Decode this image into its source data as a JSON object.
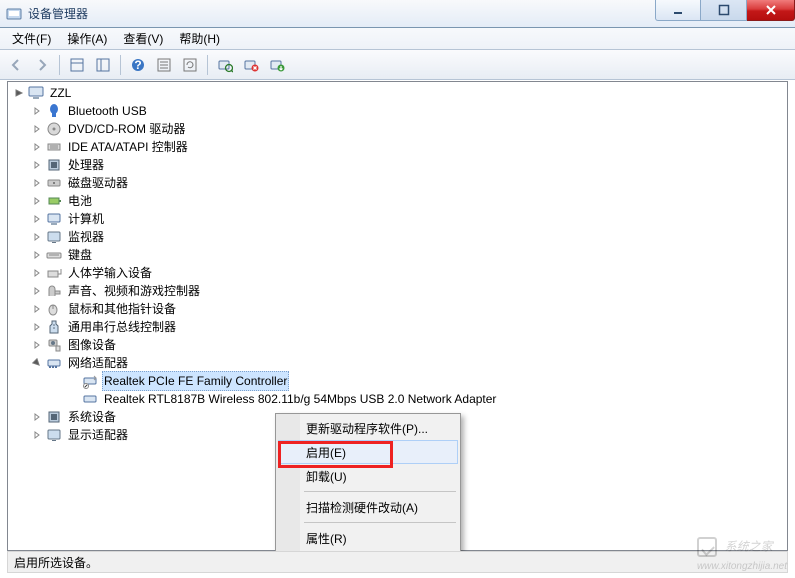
{
  "window": {
    "title": "设备管理器"
  },
  "menubar": {
    "file": "文件(F)",
    "action": "操作(A)",
    "view": "查看(V)",
    "help": "帮助(H)"
  },
  "tree": {
    "root": "ZZL",
    "items": [
      "Bluetooth USB",
      "DVD/CD-ROM 驱动器",
      "IDE ATA/ATAPI 控制器",
      "处理器",
      "磁盘驱动器",
      "电池",
      "计算机",
      "监视器",
      "键盘",
      "人体学输入设备",
      "声音、视频和游戏控制器",
      "鼠标和其他指针设备",
      "通用串行总线控制器",
      "图像设备"
    ],
    "network_adapter_label": "网络适配器",
    "adapters": {
      "a0": "Realtek PCIe FE Family Controller",
      "a1": "Realtek RTL8187B Wireless 802.11b/g 54Mbps USB 2.0 Network Adapter"
    },
    "tail": [
      "系统设备",
      "显示适配器"
    ]
  },
  "context_menu": {
    "update_driver": "更新驱动程序软件(P)...",
    "enable": "启用(E)",
    "uninstall": "卸载(U)",
    "scan": "扫描检测硬件改动(A)",
    "properties": "属性(R)"
  },
  "statusbar": {
    "text": "启用所选设备。"
  },
  "watermark": {
    "text": "系统之家",
    "url": "www.xitongzhijia.net"
  }
}
